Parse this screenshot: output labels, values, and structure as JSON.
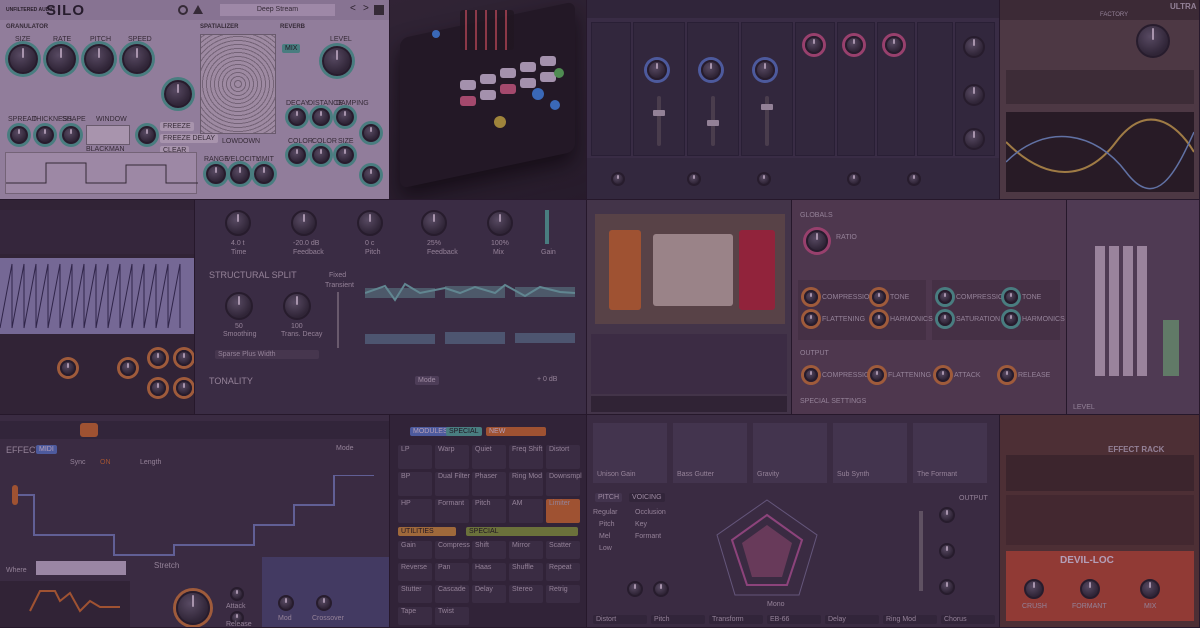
{
  "silo": {
    "brand": "UNFILTERED AUDIO",
    "title": "SILO",
    "preset": "Deep Stream",
    "nav_prev": "<",
    "nav_next": ">",
    "sections": [
      "GRANULATOR",
      "SPATIALIZER",
      "REVERB"
    ],
    "knob_labels": [
      "SIZE",
      "RATE",
      "PITCH",
      "SPEED"
    ],
    "row2_labels": [
      "SPREAD",
      "THICKNESS",
      "SHAPE",
      "WINDOW",
      "FREEZE"
    ],
    "reverb_labels": [
      "MIX",
      "LEVEL",
      "DECAY",
      "DISTANCE",
      "DAMPING",
      "COLOR",
      "COLOR",
      "SIZE"
    ],
    "window_value": "BLACKMAN",
    "buttons": [
      "FREEZE",
      "FREEZE DELAY",
      "CLEAR"
    ],
    "lfo_labels": [
      "RANGE",
      "VELOCITY",
      "LIMIT"
    ],
    "lowdown_label": "LOWDOWN"
  },
  "split": {
    "structural_label": "STRUCTURAL SPLIT",
    "top_values": [
      "4.0 t",
      "-20.0 dB",
      "0 c",
      "25%",
      "100%"
    ],
    "top_labels": [
      "Time",
      "Feedback",
      "Pitch",
      "Feedback",
      "Mix",
      "Gain"
    ],
    "knob1_value": "50",
    "knob1_label": "Smoothing",
    "knob2_value": "100",
    "knob2_label": "Trans. Decay",
    "side_labels": [
      "Fixed",
      "Transient"
    ],
    "tonality_label": "TONALITY",
    "dropdown": "Sparse Plus Width",
    "mode_label": "Mode",
    "gain": "+ 0 dB"
  },
  "effect": {
    "title": "EFFECT 1",
    "tag": "MIDI",
    "step_labels": [
      "Sync",
      "ON",
      "Length",
      "Mode"
    ],
    "stretch_label": "Stretch",
    "knob_labels": [
      "Mod",
      "Crossover",
      "Attack",
      "Release"
    ],
    "where_label": "Where"
  },
  "grid": {
    "headers": [
      "MODULES",
      "SPECIAL",
      "NEW"
    ],
    "cells": [
      "LP",
      "Warp",
      "Quiet",
      "Freq Shift",
      "Distort",
      "BP",
      "Dual Filter",
      "Phaser",
      "Ring Mod",
      "Downsmpl",
      "HP",
      "Formant",
      "Pitch",
      "AM",
      "Limiter"
    ],
    "sect2": [
      "UTILITIES",
      "SPECIAL"
    ],
    "cells2": [
      "Gain",
      "Compress",
      "Shift",
      "Mirror",
      "Scatter",
      "Reverse",
      "Pan",
      "Haas",
      "Shuffle",
      "Repeat",
      "Stutter",
      "Cascade",
      "Delay",
      "Stereo",
      "Retrig",
      "Tape",
      "Twist"
    ]
  },
  "pitch": {
    "tabs": [
      "PITCH",
      "VOICING"
    ],
    "options_left": [
      "Regular",
      "Pitch",
      "Mel",
      "Low"
    ],
    "options_right": [
      "Occlusion",
      "Key",
      "Formant"
    ],
    "bottom_tabs": [
      "Distort",
      "Pitch",
      "Transform",
      "EB-66",
      "Delay",
      "Ring Mod",
      "Chorus"
    ],
    "output_label": "OUTPUT",
    "mode_label": "Mono",
    "top_modules": [
      "Unison Gain",
      "Bass Gutter",
      "Gravity",
      "Sub Synth",
      "The Formant"
    ]
  },
  "comp": {
    "globals": "GLOBALS",
    "ratio_label": "RATIO",
    "left_knobs": [
      "COMPRESSION",
      "TONE",
      "FLATTENING",
      "HARMONICS"
    ],
    "right_knobs": [
      "COMPRESSION",
      "TONE",
      "SATURATION",
      "HARMONICS"
    ],
    "output": "OUTPUT",
    "output_knobs": [
      "COMPRESSION",
      "FLATTENING",
      "ATTACK",
      "RELEASE"
    ],
    "special": "SPECIAL SETTINGS",
    "meter_label": "LEVEL"
  },
  "rack": {
    "title": "EFFECT RACK",
    "device": "DEVIL-LOC",
    "labels": [
      "CRUSH",
      "FORMANT",
      "MIX"
    ]
  },
  "ultra": {
    "title": "ULTRA",
    "factory": "FACTORY"
  },
  "colors": {
    "teal": "#54c5a8",
    "blue": "#5a87d6",
    "pink": "#d35a8a",
    "orange": "#e08a3a",
    "overlay": "#7a4a8a"
  }
}
